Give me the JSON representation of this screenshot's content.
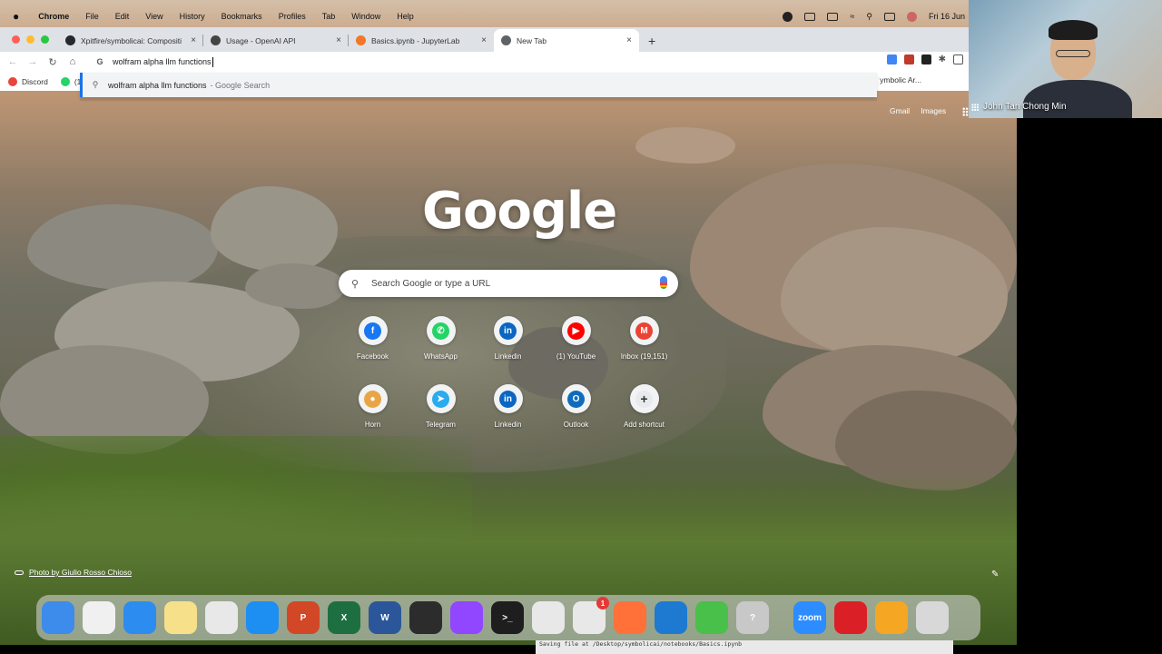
{
  "menubar": {
    "app_name": "Chrome",
    "items": [
      "File",
      "Edit",
      "View",
      "History",
      "Bookmarks",
      "Profiles",
      "Tab",
      "Window",
      "Help"
    ],
    "clock": "Fri 16 Jun"
  },
  "tabs": [
    {
      "title": "Xpitfire/symbolicai: Compositi",
      "favicon_color": "#24292f",
      "active": false
    },
    {
      "title": "Usage - OpenAI API",
      "favicon_color": "#444444",
      "active": false
    },
    {
      "title": "Basics.ipynb - JupyterLab",
      "favicon_color": "#f37726",
      "active": false
    },
    {
      "title": "New Tab",
      "favicon_color": "#5f6368",
      "active": true
    }
  ],
  "omnibox": {
    "value": "wolfram alpha llm functions"
  },
  "suggestion": {
    "query": "wolfram alpha llm functions",
    "suffix": " - Google Search"
  },
  "bookmarks": {
    "items": [
      {
        "label": "Discord",
        "color": "#e8453c"
      },
      {
        "label": "(1)",
        "color": "#25d366"
      }
    ],
    "right_label": "ymbolic Ar..."
  },
  "google": {
    "links": [
      "Gmail",
      "Images"
    ],
    "logo": "Google",
    "search_placeholder": "Search Google or type a URL",
    "shortcuts": [
      {
        "label": "Facebook",
        "color": "#1877f2",
        "glyph": "f"
      },
      {
        "label": "WhatsApp",
        "color": "#25d366",
        "glyph": "✆"
      },
      {
        "label": "Linkedin",
        "color": "#0a66c2",
        "glyph": "in"
      },
      {
        "label": "(1) YouTube",
        "color": "#ff0000",
        "glyph": "▶"
      },
      {
        "label": "Inbox (19,151)",
        "color": "#ea4335",
        "glyph": "M"
      },
      {
        "label": "Horn",
        "color": "#e9a545",
        "glyph": "●"
      },
      {
        "label": "Telegram",
        "color": "#2aabee",
        "glyph": "➤"
      },
      {
        "label": "Linkedin",
        "color": "#0a66c2",
        "glyph": "in"
      },
      {
        "label": "Outlook",
        "color": "#0f6cbd",
        "glyph": "O"
      },
      {
        "label": "Add shortcut",
        "color": "#e8eaed",
        "glyph": "+"
      }
    ],
    "photo_credit": "Photo by Giulio Rosso Chioso"
  },
  "dock": {
    "apps": [
      {
        "name": "Finder",
        "color": "#3d8bea",
        "glyph": ""
      },
      {
        "name": "Launchpad",
        "color": "#f0f0f0",
        "glyph": ""
      },
      {
        "name": "Safari",
        "color": "#2d8cf0",
        "glyph": ""
      },
      {
        "name": "Notes",
        "color": "#f7e08a",
        "glyph": ""
      },
      {
        "name": "Chrome",
        "color": "#e8e8e8",
        "glyph": ""
      },
      {
        "name": "App Store",
        "color": "#1d8ef2",
        "glyph": ""
      },
      {
        "name": "PowerPoint",
        "color": "#d24726",
        "glyph": "P"
      },
      {
        "name": "Excel",
        "color": "#1d6f42",
        "glyph": "X"
      },
      {
        "name": "Word",
        "color": "#2b579a",
        "glyph": "W"
      },
      {
        "name": "Unity",
        "color": "#2c2c2c",
        "glyph": ""
      },
      {
        "name": "Twitch",
        "color": "#9146ff",
        "glyph": ""
      },
      {
        "name": "Terminal",
        "color": "#1e1e1e",
        "glyph": ">_"
      },
      {
        "name": "Script Editor",
        "color": "#e8e8e8",
        "glyph": ""
      },
      {
        "name": "Microsoft",
        "color": "#e8e8e8",
        "glyph": "",
        "badge": "1"
      },
      {
        "name": "Firefox",
        "color": "#ff7139",
        "glyph": ""
      },
      {
        "name": "VS Code",
        "color": "#1e7ad0",
        "glyph": ""
      },
      {
        "name": "Activity",
        "color": "#48c04a",
        "glyph": ""
      },
      {
        "name": "Help",
        "color": "#c8c8c8",
        "glyph": "?"
      },
      {
        "name": "Zoom",
        "color": "#2d8cff",
        "glyph": "zoom"
      },
      {
        "name": "Creative Cloud",
        "color": "#da1f26",
        "glyph": ""
      },
      {
        "name": "Home",
        "color": "#f5a623",
        "glyph": ""
      },
      {
        "name": "Trash",
        "color": "#d8d8d8",
        "glyph": ""
      }
    ],
    "terminal_text": "Saving file at /Desktop/symbolicai/notebooks/Basics.ipynb"
  },
  "participant": {
    "name": "John Tan Chong Min"
  }
}
